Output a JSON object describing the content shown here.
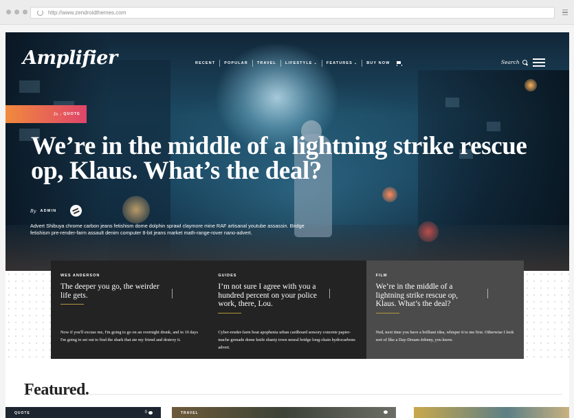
{
  "browser": {
    "url": "http://www.zendroidthemes.com"
  },
  "site": {
    "logo": "Amplifier"
  },
  "nav": {
    "items": [
      {
        "label": "RECENT"
      },
      {
        "label": "POPULAR"
      },
      {
        "label": "TRAVEL"
      },
      {
        "label": "LIFESTYLE"
      },
      {
        "label": "FEATURES"
      },
      {
        "label": "BUY NOW"
      }
    ],
    "search_label": "Search"
  },
  "hero": {
    "category_prefix": "In",
    "category": "QUOTE",
    "title": "We’re in the middle of a lightning strike rescue op, Klaus. What’s the deal?",
    "by_label": "By",
    "author": "ADMIN",
    "excerpt": "Advert Shibuya chrome carbon jeans fetishism dome dolphin sprawl claymore mine RAF artisanal youtube assassin. Bridge fetishism pre-render-farm assault denim computer 8-bit jeans market math-range-rover nano-advert."
  },
  "cards": [
    {
      "category": "WES ANDERSON",
      "title": "The deeper you go, the weirder life gets.",
      "text": "Now if you'll excuse me, I'm going to go on an overnight drunk, and in 10 days I'm going to set out to find the shark that ate my friend and destroy it."
    },
    {
      "category": "GUIDES",
      "title": "I’m not sure I agree with you a hundred percent on your police work, there, Lou.",
      "text": "Cyber-render-farm boat apophenia urban cardboard sensory concrete papier-mache grenade dome knife shanty town neural bridge long-chain hydrocarbons advert."
    },
    {
      "category": "FILM",
      "title": "We’re in the middle of a lightning strike rescue op, Klaus. What’s the deal?",
      "text": "Ned, next time you have a brilliant idea, whisper it to me first. Otherwise I look sort of like a Day-Dream-Johnny, you know."
    }
  ],
  "featured": {
    "heading": "Featured.",
    "items": [
      {
        "category": "QUOTE",
        "comments": "0"
      },
      {
        "category": "TRAVEL",
        "comments": ""
      },
      {
        "category": "",
        "comments": ""
      }
    ]
  }
}
